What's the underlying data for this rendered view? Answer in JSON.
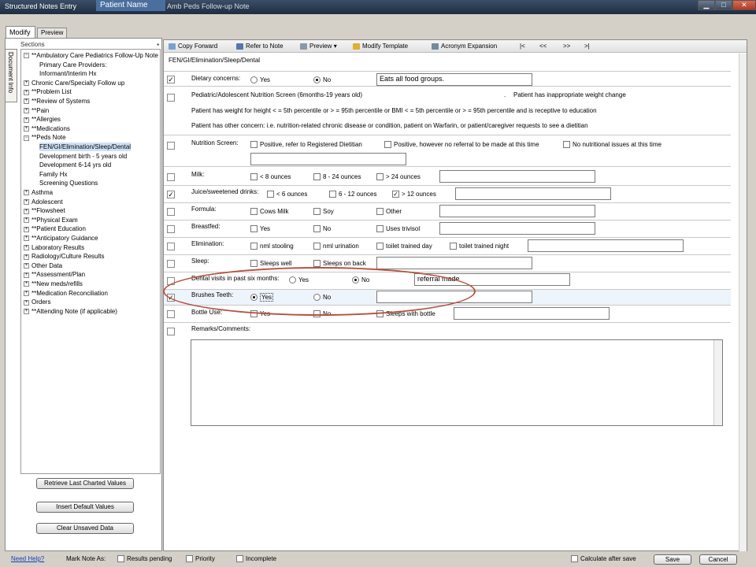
{
  "window": {
    "title_left": "Structured Notes Entry",
    "patient_name": "Patient Name",
    "title_center": "Amb Peds Follow-up Note",
    "minimize_icon": "minimize-icon",
    "maximize_icon": "maximize-icon",
    "close_icon": "close-icon"
  },
  "tabs": {
    "modify": "Modify",
    "preview": "Preview"
  },
  "left": {
    "doc_info": "Document Info",
    "sections_label": "Sections",
    "pin_icon": "pin-icon",
    "tree": [
      {
        "label": "**Ambulatory Care Pediatrics Follow-Up Note",
        "exp": "−"
      },
      {
        "label": "Primary Care Providers:",
        "exp": ""
      },
      {
        "label": "Informant/Interim Hx",
        "exp": ""
      },
      {
        "label": "Chronic Care/Specialty Follow up",
        "exp": "+"
      },
      {
        "label": "**Problem List",
        "exp": "+"
      },
      {
        "label": "**Review of Systems",
        "exp": "+"
      },
      {
        "label": "**Pain",
        "exp": "+"
      },
      {
        "label": "**Allergies",
        "exp": "+"
      },
      {
        "label": "**Medications",
        "exp": "+"
      },
      {
        "label": "**Peds Note",
        "exp": "−"
      },
      {
        "label": "FEN/GI/Elimination/Sleep/Dental",
        "exp": ""
      },
      {
        "label": "Development birth - 5 years old",
        "exp": ""
      },
      {
        "label": "Development 6-14 yrs old",
        "exp": ""
      },
      {
        "label": "Family Hx",
        "exp": ""
      },
      {
        "label": "Screening Questions",
        "exp": ""
      },
      {
        "label": "Asthma",
        "exp": "+"
      },
      {
        "label": "Adolescent",
        "exp": "+"
      },
      {
        "label": "**Flowsheet",
        "exp": "+"
      },
      {
        "label": "**Physical Exam",
        "exp": "+"
      },
      {
        "label": "**Patient Education",
        "exp": "+"
      },
      {
        "label": "**Anticipatory Guidance",
        "exp": "+"
      },
      {
        "label": "Laboratory Results",
        "exp": "+"
      },
      {
        "label": "Radiology/Culture Results",
        "exp": "+"
      },
      {
        "label": "Other Data",
        "exp": "+"
      },
      {
        "label": "**Assessment/Plan",
        "exp": "+"
      },
      {
        "label": "**New meds/refills",
        "exp": "+"
      },
      {
        "label": "**Medication Reconciliation",
        "exp": "+"
      },
      {
        "label": "Orders",
        "exp": "+"
      },
      {
        "label": "**Attending Note (if applicable)",
        "exp": "+"
      }
    ],
    "buttons": {
      "retrieve": "Retrieve Last Charted Values",
      "insert": "Insert Default Values",
      "clear": "Clear Unsaved Data"
    }
  },
  "toolbar": {
    "copy_forward": "Copy Forward",
    "refer_to_note": "Refer to Note",
    "preview": "Preview",
    "modify_template": "Modify Template",
    "acronym_expansion": "Acronym Expansion",
    "nav_first": "|<",
    "nav_prev": "<<",
    "nav_next": ">>",
    "nav_last": ">|"
  },
  "form": {
    "section_title": "FEN/GI/Elimination/Sleep/Dental",
    "dietary": {
      "label": "Dietary concerns:",
      "yes": "Yes",
      "no": "No",
      "text": "Eats all food groups.",
      "checked": "✓"
    },
    "screen": {
      "title": "Pediatric/Adolescent Nutrition Screen (6months-19 years old)",
      "dot": ".",
      "weight_change": "Patient has inappropriate weight change",
      "height_line": "Patient has weight for height < = 5th percentile or > = 95th percentile or BMI < = 5th percentile or > = 95th percentile and is receptive to education",
      "other_line": "Patient has other concern: i.e. nutrition-related chronic disease or condition, patient on Warfarin, or patient/caregiver requests to see a dietitian"
    },
    "nutrition": {
      "label": "Nutrition Screen:",
      "opt1": "Positive, refer to Registered Dietitian",
      "opt2": "Positive, however no referral to be made at this time",
      "opt3": "No nutritional issues at this time"
    },
    "milk": {
      "label": "Milk:",
      "opt1": "< 8 ounces",
      "opt2": "8 - 24 ounces",
      "opt3": "> 24 ounces"
    },
    "juice": {
      "label": "Juice/sweetened drinks:",
      "opt1": "< 6 ounces",
      "opt2": "6 - 12 ounces",
      "opt3": "> 12 ounces",
      "checked": "✓"
    },
    "formula": {
      "label": "Formula:",
      "opt1": "Cows Milk",
      "opt2": "Soy",
      "opt3": "Other"
    },
    "breastfed": {
      "label": "Breastfed:",
      "opt1": "Yes",
      "opt2": "No",
      "opt3": "Uses trivisol"
    },
    "elimination": {
      "label": "Elimination:",
      "opt1": "nml stooling",
      "opt2": "nml urination",
      "opt3": "toilet trained day",
      "opt4": "toilet trained night"
    },
    "sleep": {
      "label": "Sleep:",
      "opt1": "Sleeps well",
      "opt2": "Sleeps on back"
    },
    "dental": {
      "label": "Dental visits in past six months:",
      "yes": "Yes",
      "no": "No",
      "text": "referral made"
    },
    "brushes": {
      "label": "Brushes Teeth:",
      "yes": "Yes",
      "no": "No",
      "checked": "✓"
    },
    "bottle": {
      "label": "Bottle Use:",
      "opt1": "Yes",
      "opt2": "No",
      "opt3": "Sleeps with bottle"
    },
    "remarks": {
      "label": "Remarks/Comments:"
    }
  },
  "status": {
    "help": "Need Help?",
    "mark_note_as": "Mark Note As:",
    "results_pending": "Results pending",
    "priority": "Priority",
    "incomplete": "Incomplete",
    "calc_after_save": "Calculate after save",
    "save": "Save",
    "cancel": "Cancel"
  }
}
